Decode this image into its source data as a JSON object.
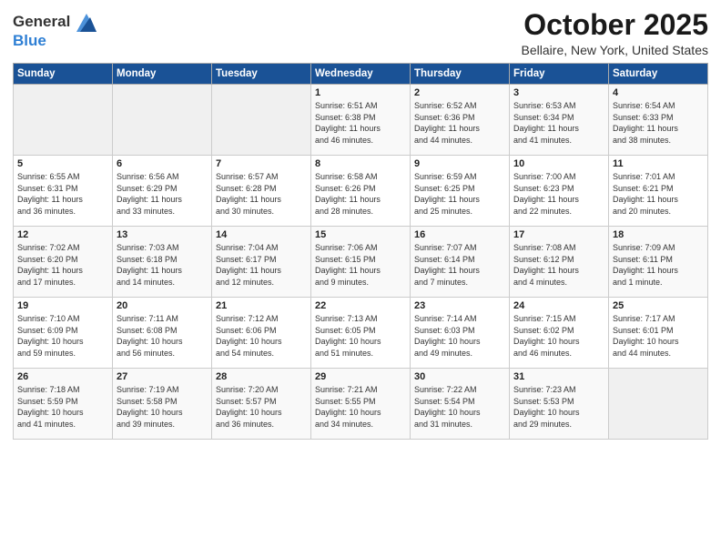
{
  "logo": {
    "line1": "General",
    "line2": "Blue"
  },
  "title": "October 2025",
  "subtitle": "Bellaire, New York, United States",
  "headers": [
    "Sunday",
    "Monday",
    "Tuesday",
    "Wednesday",
    "Thursday",
    "Friday",
    "Saturday"
  ],
  "weeks": [
    [
      {
        "day": "",
        "info": ""
      },
      {
        "day": "",
        "info": ""
      },
      {
        "day": "",
        "info": ""
      },
      {
        "day": "1",
        "info": "Sunrise: 6:51 AM\nSunset: 6:38 PM\nDaylight: 11 hours\nand 46 minutes."
      },
      {
        "day": "2",
        "info": "Sunrise: 6:52 AM\nSunset: 6:36 PM\nDaylight: 11 hours\nand 44 minutes."
      },
      {
        "day": "3",
        "info": "Sunrise: 6:53 AM\nSunset: 6:34 PM\nDaylight: 11 hours\nand 41 minutes."
      },
      {
        "day": "4",
        "info": "Sunrise: 6:54 AM\nSunset: 6:33 PM\nDaylight: 11 hours\nand 38 minutes."
      }
    ],
    [
      {
        "day": "5",
        "info": "Sunrise: 6:55 AM\nSunset: 6:31 PM\nDaylight: 11 hours\nand 36 minutes."
      },
      {
        "day": "6",
        "info": "Sunrise: 6:56 AM\nSunset: 6:29 PM\nDaylight: 11 hours\nand 33 minutes."
      },
      {
        "day": "7",
        "info": "Sunrise: 6:57 AM\nSunset: 6:28 PM\nDaylight: 11 hours\nand 30 minutes."
      },
      {
        "day": "8",
        "info": "Sunrise: 6:58 AM\nSunset: 6:26 PM\nDaylight: 11 hours\nand 28 minutes."
      },
      {
        "day": "9",
        "info": "Sunrise: 6:59 AM\nSunset: 6:25 PM\nDaylight: 11 hours\nand 25 minutes."
      },
      {
        "day": "10",
        "info": "Sunrise: 7:00 AM\nSunset: 6:23 PM\nDaylight: 11 hours\nand 22 minutes."
      },
      {
        "day": "11",
        "info": "Sunrise: 7:01 AM\nSunset: 6:21 PM\nDaylight: 11 hours\nand 20 minutes."
      }
    ],
    [
      {
        "day": "12",
        "info": "Sunrise: 7:02 AM\nSunset: 6:20 PM\nDaylight: 11 hours\nand 17 minutes."
      },
      {
        "day": "13",
        "info": "Sunrise: 7:03 AM\nSunset: 6:18 PM\nDaylight: 11 hours\nand 14 minutes."
      },
      {
        "day": "14",
        "info": "Sunrise: 7:04 AM\nSunset: 6:17 PM\nDaylight: 11 hours\nand 12 minutes."
      },
      {
        "day": "15",
        "info": "Sunrise: 7:06 AM\nSunset: 6:15 PM\nDaylight: 11 hours\nand 9 minutes."
      },
      {
        "day": "16",
        "info": "Sunrise: 7:07 AM\nSunset: 6:14 PM\nDaylight: 11 hours\nand 7 minutes."
      },
      {
        "day": "17",
        "info": "Sunrise: 7:08 AM\nSunset: 6:12 PM\nDaylight: 11 hours\nand 4 minutes."
      },
      {
        "day": "18",
        "info": "Sunrise: 7:09 AM\nSunset: 6:11 PM\nDaylight: 11 hours\nand 1 minute."
      }
    ],
    [
      {
        "day": "19",
        "info": "Sunrise: 7:10 AM\nSunset: 6:09 PM\nDaylight: 10 hours\nand 59 minutes."
      },
      {
        "day": "20",
        "info": "Sunrise: 7:11 AM\nSunset: 6:08 PM\nDaylight: 10 hours\nand 56 minutes."
      },
      {
        "day": "21",
        "info": "Sunrise: 7:12 AM\nSunset: 6:06 PM\nDaylight: 10 hours\nand 54 minutes."
      },
      {
        "day": "22",
        "info": "Sunrise: 7:13 AM\nSunset: 6:05 PM\nDaylight: 10 hours\nand 51 minutes."
      },
      {
        "day": "23",
        "info": "Sunrise: 7:14 AM\nSunset: 6:03 PM\nDaylight: 10 hours\nand 49 minutes."
      },
      {
        "day": "24",
        "info": "Sunrise: 7:15 AM\nSunset: 6:02 PM\nDaylight: 10 hours\nand 46 minutes."
      },
      {
        "day": "25",
        "info": "Sunrise: 7:17 AM\nSunset: 6:01 PM\nDaylight: 10 hours\nand 44 minutes."
      }
    ],
    [
      {
        "day": "26",
        "info": "Sunrise: 7:18 AM\nSunset: 5:59 PM\nDaylight: 10 hours\nand 41 minutes."
      },
      {
        "day": "27",
        "info": "Sunrise: 7:19 AM\nSunset: 5:58 PM\nDaylight: 10 hours\nand 39 minutes."
      },
      {
        "day": "28",
        "info": "Sunrise: 7:20 AM\nSunset: 5:57 PM\nDaylight: 10 hours\nand 36 minutes."
      },
      {
        "day": "29",
        "info": "Sunrise: 7:21 AM\nSunset: 5:55 PM\nDaylight: 10 hours\nand 34 minutes."
      },
      {
        "day": "30",
        "info": "Sunrise: 7:22 AM\nSunset: 5:54 PM\nDaylight: 10 hours\nand 31 minutes."
      },
      {
        "day": "31",
        "info": "Sunrise: 7:23 AM\nSunset: 5:53 PM\nDaylight: 10 hours\nand 29 minutes."
      },
      {
        "day": "",
        "info": ""
      }
    ]
  ]
}
